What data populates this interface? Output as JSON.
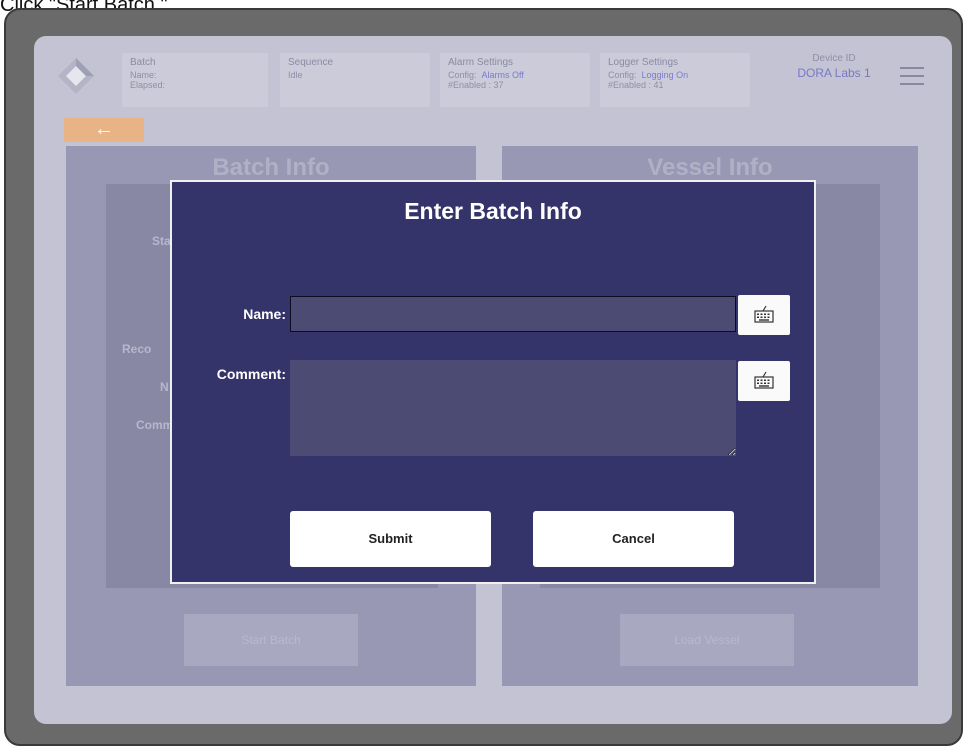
{
  "instruction": "Click \"Start Batch.\"",
  "header": {
    "batch": {
      "title": "Batch",
      "name_label": "Name:",
      "elapsed_label": "Elapsed:"
    },
    "sequence": {
      "title": "Sequence",
      "value": "Idle"
    },
    "alarm": {
      "title": "Alarm Settings",
      "config_label": "Config:",
      "config_value": "Alarms Off",
      "enabled": "#Enabled : 37"
    },
    "logger": {
      "title": "Logger Settings",
      "config_label": "Config:",
      "config_value": "Logging On",
      "enabled": "#Enabled : 41"
    },
    "device": {
      "title": "Device ID",
      "value": "DORA Labs 1"
    }
  },
  "back_label": "←",
  "batch_panel": {
    "title": "Batch Info",
    "labels": [
      "Sta",
      "Reco",
      "N",
      "Comm"
    ],
    "button": "Start Batch"
  },
  "vessel_panel": {
    "title": "Vessel Info",
    "button": "Load Vessel"
  },
  "modal": {
    "title": "Enter Batch Info",
    "name_label": "Name:",
    "name_value": "",
    "comment_label": "Comment:",
    "comment_value": "",
    "submit": "Submit",
    "cancel": "Cancel"
  },
  "colors": {
    "modal_bg": "#34346a",
    "accent_orange": "#e8b486",
    "screen_bg": "#c3c3d3"
  }
}
